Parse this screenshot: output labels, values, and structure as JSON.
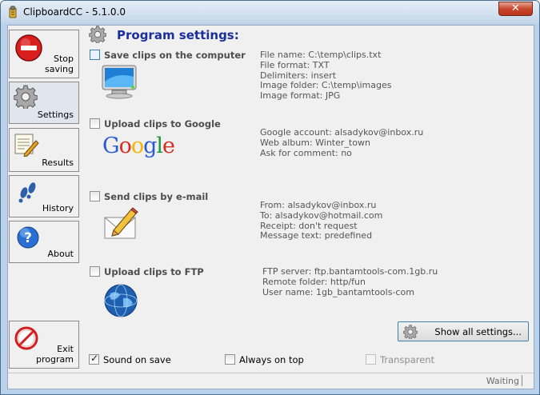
{
  "window": {
    "title": "ClipboardCC - 5.1.0.0",
    "close_glyph": "✕"
  },
  "sidebar": {
    "stop": {
      "line1": "Stop",
      "line2": "saving"
    },
    "settings": "Settings",
    "results": "Results",
    "history": "History",
    "about": "About",
    "exit": {
      "line1": "Exit",
      "line2": "program"
    }
  },
  "main": {
    "heading": "Program settings:",
    "sections": [
      {
        "title": "Save clips on the computer",
        "checked": false,
        "info": [
          "File name: C:\\temp\\clips.txt",
          "File format: TXT",
          "Delimiters: insert",
          "Image folder: C:\\temp\\images",
          "Image format: JPG"
        ]
      },
      {
        "title": "Upload clips to Google",
        "checked": false,
        "info": [
          "Google account: alsadykov@inbox.ru",
          "Web album: Winter_town",
          "Ask for comment: no"
        ]
      },
      {
        "title": "Send clips by e-mail",
        "checked": false,
        "info": [
          "From: alsadykov@inbox.ru",
          "To: alsadykov@hotmail.com",
          "Receipt: don't request",
          "Message text: predefined"
        ]
      },
      {
        "title": "Upload clips to FTP",
        "checked": false,
        "info": [
          "FTP server: ftp.bantamtools-com.1gb.ru",
          "Remote folder: http/fun",
          "User name: 1gb_bantamtools-com"
        ]
      }
    ],
    "google_logo": "Google",
    "show_all_button": "Show all settings..."
  },
  "options": {
    "sound_on_save": {
      "label": "Sound on save",
      "checked": true
    },
    "always_on_top": {
      "label": "Always on top",
      "checked": false
    },
    "transparent": {
      "label": "Transparent",
      "checked": false,
      "disabled": true
    }
  },
  "status": {
    "text": "Waiting"
  },
  "icons": {
    "stop": "stop-sign-icon",
    "settings": "gear-icon",
    "results": "notepad-pencil-icon",
    "history": "footprints-icon",
    "about": "help-icon",
    "exit": "no-entry-icon",
    "computer": "monitor-icon",
    "email": "envelope-pencil-icon",
    "ftp": "globe-icon"
  }
}
